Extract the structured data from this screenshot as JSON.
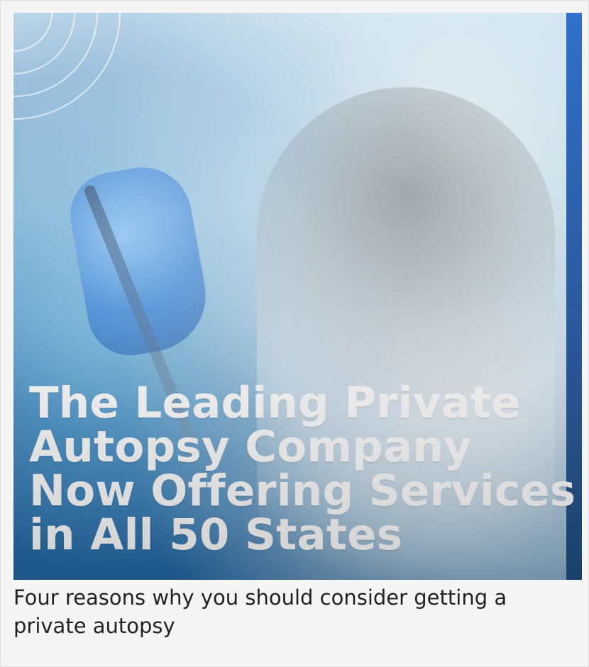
{
  "hero": {
    "headline_lines": [
      "The Leading Private",
      "Autopsy Company",
      "Now Offering Services",
      "in All 50 States"
    ]
  },
  "caption": {
    "lines": [
      "Four reasons why you should consider getting a",
      "private autopsy"
    ]
  },
  "icons": {
    "rings": "concentric-arc-rings-icon"
  },
  "colors": {
    "caption_text": "#222222",
    "headline_text": "#ffffff",
    "hero_blue": "#1f5f98"
  }
}
